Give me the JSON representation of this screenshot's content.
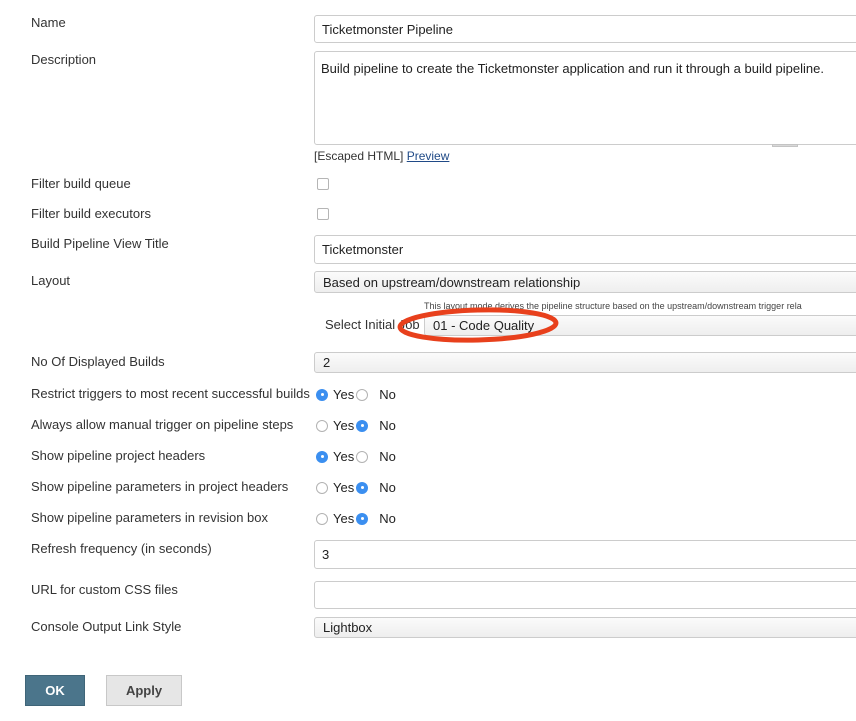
{
  "form": {
    "name": {
      "label": "Name",
      "value": "Ticketmonster Pipeline"
    },
    "description": {
      "label": "Description",
      "value": "Build pipeline to create the Ticketmonster application and run it through a build pipeline.",
      "escaped_html_text": "[Escaped HTML]",
      "preview_link": "Preview"
    },
    "filter_build_queue": {
      "label": "Filter build queue",
      "checked": false
    },
    "filter_build_executors": {
      "label": "Filter build executors",
      "checked": false
    },
    "view_title": {
      "label": "Build Pipeline View Title",
      "value": "Ticketmonster"
    },
    "layout": {
      "label": "Layout",
      "selected": "Based on upstream/downstream relationship",
      "help_text": "This layout mode derives the pipeline structure based on the upstream/downstream trigger rela",
      "initial_job_label": "Select Initial Job",
      "initial_job_selected": "01 - Code Quality"
    },
    "displayed_builds": {
      "label": "No Of Displayed Builds",
      "selected": "2"
    },
    "restrict_triggers": {
      "label": "Restrict triggers to most recent successful builds",
      "value": "Yes"
    },
    "manual_trigger": {
      "label": "Always allow manual trigger on pipeline steps",
      "value": "No"
    },
    "project_headers": {
      "label": "Show pipeline project headers",
      "value": "Yes"
    },
    "params_project_headers": {
      "label": "Show pipeline parameters in project headers",
      "value": "No"
    },
    "params_revision_box": {
      "label": "Show pipeline parameters in revision box",
      "value": "No"
    },
    "refresh_frequency": {
      "label": "Refresh frequency (in seconds)",
      "value": "3"
    },
    "custom_css": {
      "label": "URL for custom CSS files",
      "value": ""
    },
    "console_link_style": {
      "label": "Console Output Link Style",
      "selected": "Lightbox"
    }
  },
  "radio_labels": {
    "yes": "Yes",
    "no": "No"
  },
  "buttons": {
    "ok": "OK",
    "apply": "Apply"
  },
  "colors": {
    "ok_button": "#4b758b",
    "radio_selected": "#3b8ff0",
    "link": "#204a87",
    "annotation": "#e8401c"
  }
}
